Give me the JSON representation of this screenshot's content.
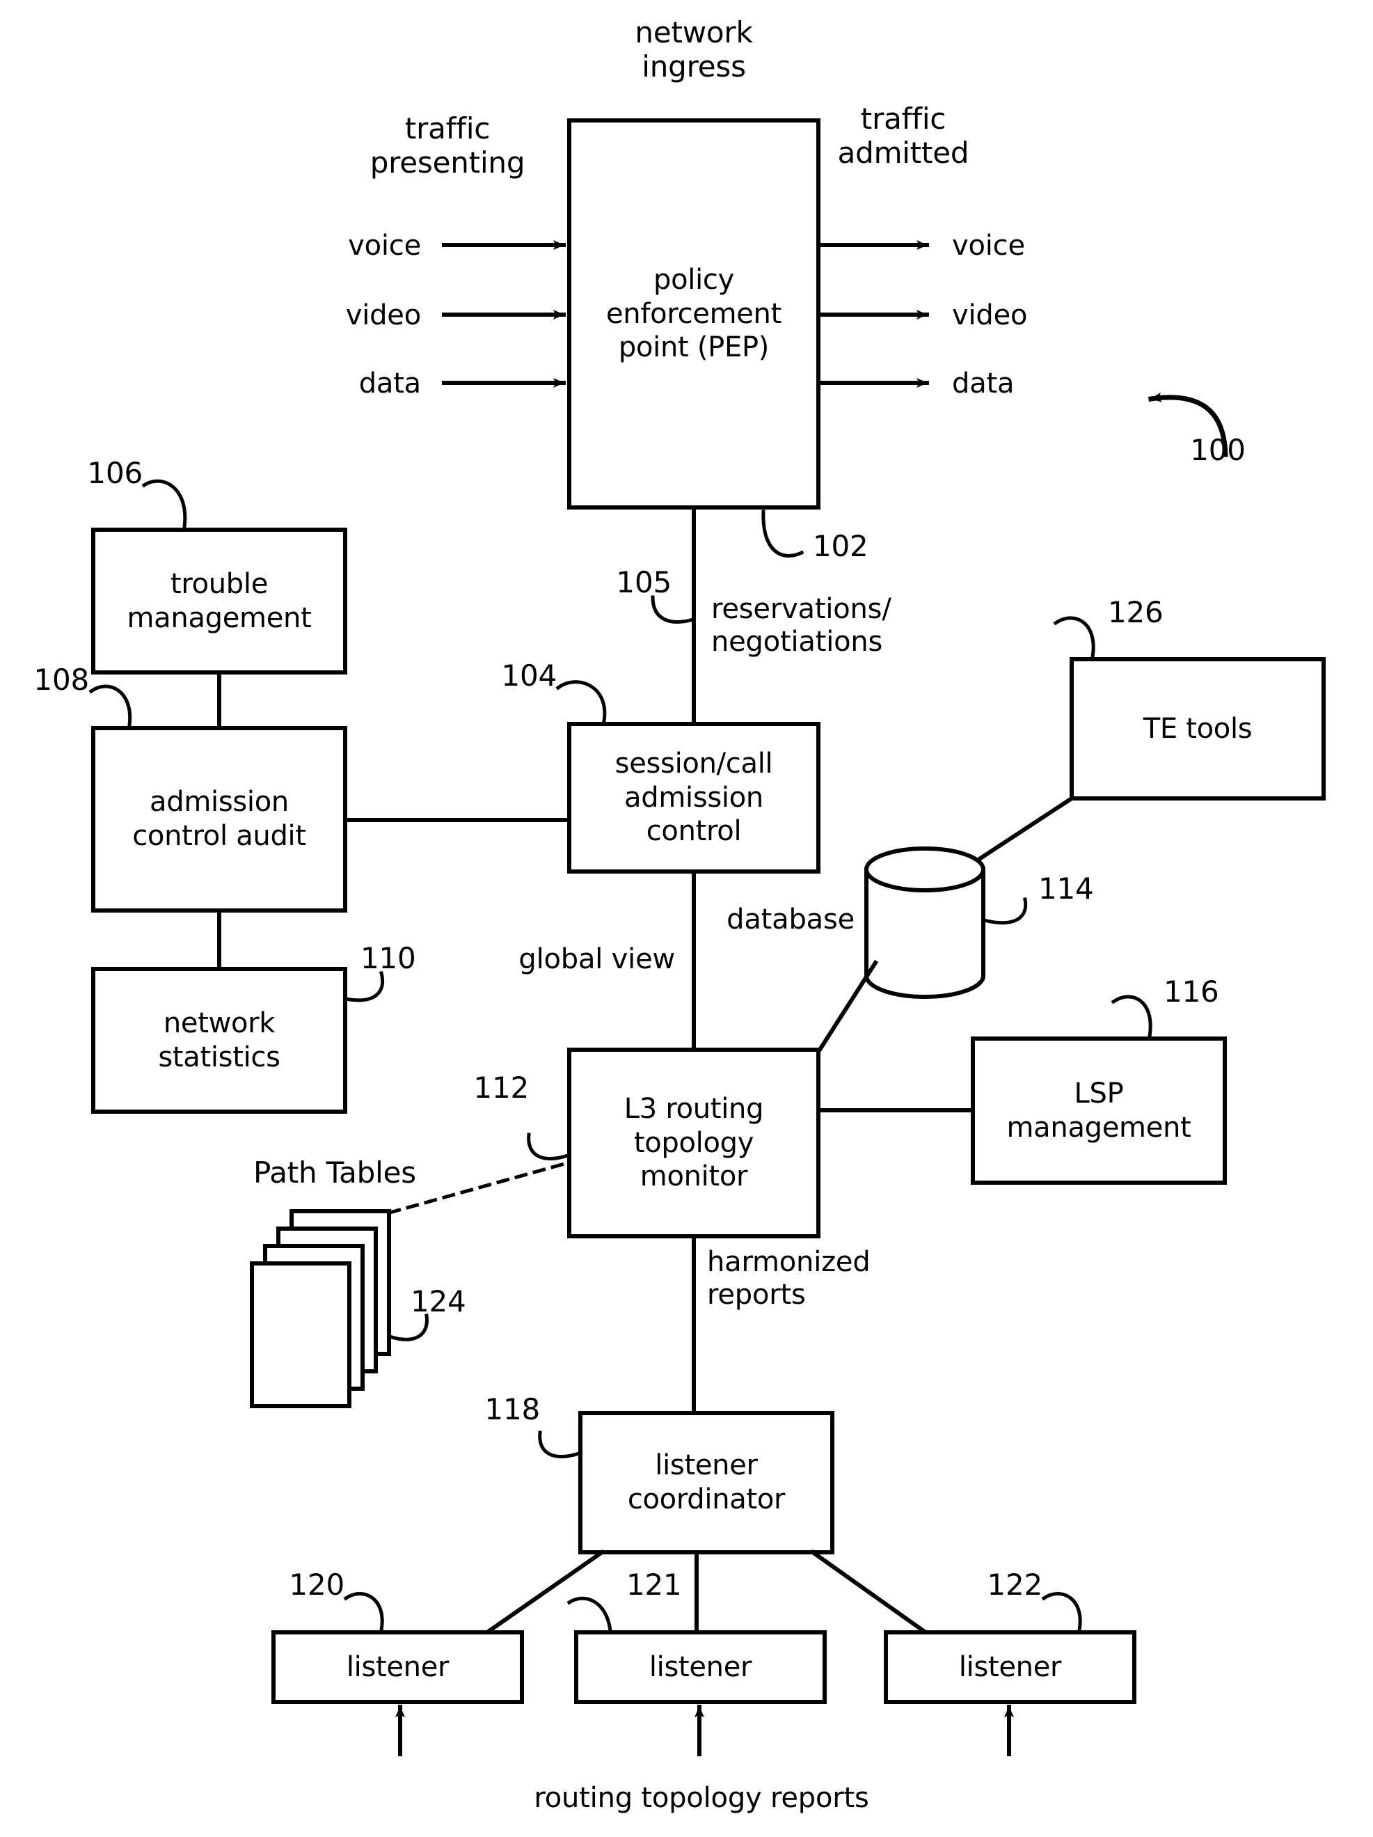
{
  "figure": {
    "ref_label": "100",
    "title_note": "network ingress"
  },
  "top": {
    "network_ingress": "network\ningress",
    "traffic_presenting": "traffic\npresenting",
    "traffic_admitted": "traffic\nadmitted",
    "inputs": [
      "voice",
      "video",
      "data"
    ],
    "outputs": [
      "voice",
      "video",
      "data"
    ]
  },
  "boxes": {
    "pep": {
      "label": "policy\nenforcement\npoint (PEP)",
      "ref": "102"
    },
    "trouble_management": {
      "label": "trouble\nmanagement",
      "ref": "106"
    },
    "admission_control_audit": {
      "label": "admission\ncontrol audit",
      "ref": "108"
    },
    "network_statistics": {
      "label": "network\nstatistics",
      "ref": "110"
    },
    "session_call_admission_control": {
      "label": "session/call\nadmission\ncontrol",
      "ref": "104"
    },
    "te_tools": {
      "label": "TE tools",
      "ref": "126"
    },
    "database": {
      "label": "database",
      "ref": "114"
    },
    "lsp_management": {
      "label": "LSP\nmanagement",
      "ref": "116"
    },
    "l3_routing_topology_monitor": {
      "label": "L3 routing\ntopology\nmonitor",
      "ref": "112"
    },
    "path_tables": {
      "label": "Path Tables",
      "ref": "124"
    },
    "listener_coordinator": {
      "label": "listener\ncoordinator",
      "ref": "118"
    },
    "listener_left": {
      "label": "listener",
      "ref": "120"
    },
    "listener_center": {
      "label": "listener",
      "ref": "121"
    },
    "listener_right": {
      "label": "listener",
      "ref": "122"
    }
  },
  "edge_labels": {
    "reservations_negotiations": "reservations/\nnegotiations",
    "link_105": "105",
    "global_view": "global view",
    "harmonized_reports": "harmonized\nreports",
    "routing_topology_reports": "routing topology reports"
  },
  "colors": {
    "stroke": "#000000",
    "fill": "#ffffff",
    "background": "#ffffff"
  }
}
